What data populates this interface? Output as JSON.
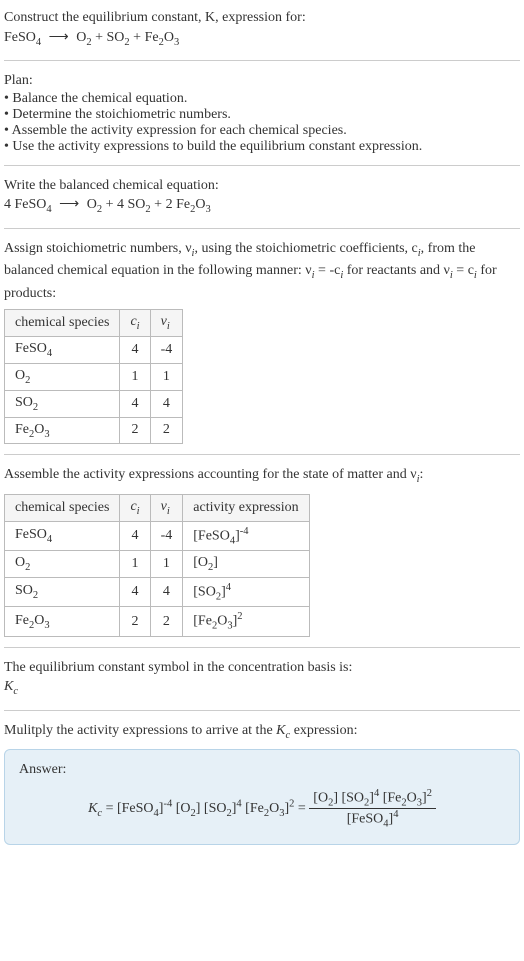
{
  "intro_line1": "Construct the equilibrium constant, K, expression for:",
  "intro_eq_reactant": "FeSO",
  "intro_eq_sub1": "4",
  "intro_eq_prod1": "O",
  "intro_eq_prod1_sub": "2",
  "intro_eq_prod2": "SO",
  "intro_eq_prod2_sub": "2",
  "intro_eq_prod3": "Fe",
  "intro_eq_prod3_sub1": "2",
  "intro_eq_prod3_b": "O",
  "intro_eq_prod3_sub2": "3",
  "plan_heading": "Plan:",
  "plan_items": [
    "Balance the chemical equation.",
    "Determine the stoichiometric numbers.",
    "Assemble the activity expression for each chemical species.",
    "Use the activity expressions to build the equilibrium constant expression."
  ],
  "balanced_heading": "Write the balanced chemical equation:",
  "bal_c1": "4 ",
  "bal_r": "FeSO",
  "bal_c2": "4 ",
  "bal_c3": "2 ",
  "stoich_text1": "Assign stoichiometric numbers, ν",
  "stoich_sub_i1": "i",
  "stoich_text2": ", using the stoichiometric coefficients, c",
  "stoich_sub_i2": "i",
  "stoich_text3": ", from the balanced chemical equation in the following manner: ν",
  "stoich_sub_i3": "i",
  "stoich_text4": " = -c",
  "stoich_sub_i4": "i",
  "stoich_text5": " for reactants and ν",
  "stoich_sub_i5": "i",
  "stoich_text6": " = c",
  "stoich_sub_i6": "i",
  "stoich_text7": " for products:",
  "table1": {
    "h1": "chemical species",
    "h2": "c",
    "h2sub": "i",
    "h3": "ν",
    "h3sub": "i",
    "rows": [
      {
        "s": "FeSO",
        "ssub": "4",
        "s2": "",
        "ssub2": "",
        "c": "4",
        "v": "-4"
      },
      {
        "s": "O",
        "ssub": "2",
        "s2": "",
        "ssub2": "",
        "c": "1",
        "v": "1"
      },
      {
        "s": "SO",
        "ssub": "2",
        "s2": "",
        "ssub2": "",
        "c": "4",
        "v": "4"
      },
      {
        "s": "Fe",
        "ssub": "2",
        "s2": "O",
        "ssub2": "3",
        "c": "2",
        "v": "2"
      }
    ]
  },
  "assemble_text1": "Assemble the activity expressions accounting for the state of matter and ν",
  "assemble_sub_i": "i",
  "assemble_text2": ":",
  "table2": {
    "h1": "chemical species",
    "h2": "c",
    "h2sub": "i",
    "h3": "ν",
    "h3sub": "i",
    "h4": "activity expression"
  },
  "eq_symbol_text": "The equilibrium constant symbol in the concentration basis is:",
  "kc_sym": "K",
  "kc_sub": "c",
  "multiply_text1": "Mulitply the activity expressions to arrive at the ",
  "multiply_text2": " expression:",
  "answer_label": "Answer:"
}
